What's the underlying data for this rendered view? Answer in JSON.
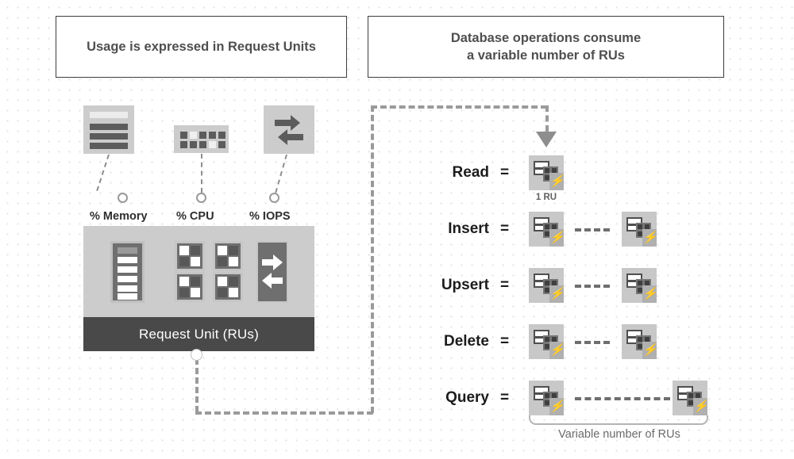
{
  "titles": {
    "left": "Usage is expressed in Request Units",
    "right_line1": "Database operations consume",
    "right_line2": "a variable number of RUs"
  },
  "metrics": [
    {
      "label": "% Memory",
      "icon": "memory-bars-icon"
    },
    {
      "label": "% CPU",
      "icon": "cpu-chip-icon"
    },
    {
      "label": "% IOPS",
      "icon": "io-arrows-icon"
    }
  ],
  "ru_panel": {
    "bar_label": "Request Unit (RUs)",
    "icons": [
      "memory-stick-icon",
      "cpu-quad-icon",
      "io-arrows-icon"
    ]
  },
  "operations": [
    {
      "name": "Read",
      "cost_label": "1 RU",
      "dash_width": 44,
      "span": "single"
    },
    {
      "name": "Insert",
      "cost_label": "",
      "dash_width": 44,
      "span": "short"
    },
    {
      "name": "Upsert",
      "cost_label": "",
      "dash_width": 44,
      "span": "short"
    },
    {
      "name": "Delete",
      "cost_label": "",
      "dash_width": 44,
      "span": "short"
    },
    {
      "name": "Query",
      "cost_label": "",
      "dash_width": 140,
      "span": "long"
    }
  ],
  "operator_symbol": "=",
  "variable_caption": "Variable number of RUs",
  "bolt_glyph": "⚡",
  "colors": {
    "panel_fill": "#cccccc",
    "panel_bar": "#494949",
    "icon_dark": "#6f6f6f",
    "dash": "#9a9a9a",
    "text_dark": "#1c1c1c",
    "text_muted": "#6a6a6a",
    "border": "#3d3d3d",
    "background": "#ffffff"
  }
}
